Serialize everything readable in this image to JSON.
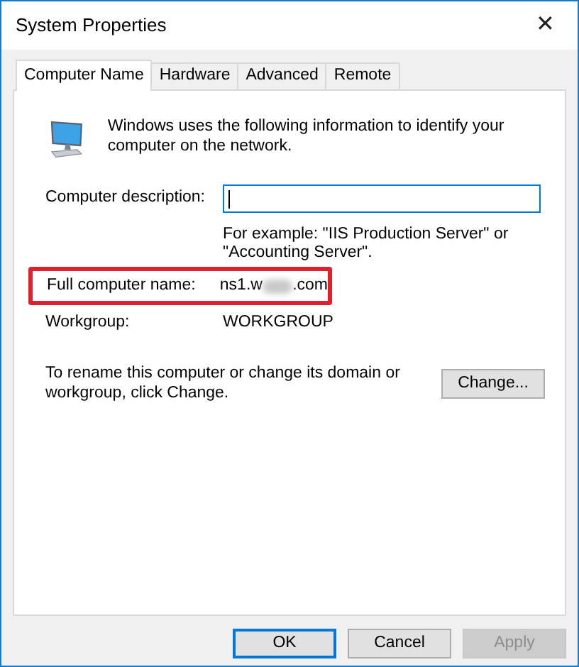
{
  "window": {
    "title": "System Properties",
    "close": "✕"
  },
  "tabs": [
    {
      "label": "Computer Name",
      "selected": true
    },
    {
      "label": "Hardware",
      "selected": false
    },
    {
      "label": "Advanced",
      "selected": false
    },
    {
      "label": "Remote",
      "selected": false
    }
  ],
  "intro": "Windows uses the following information to identify your computer on the network.",
  "description": {
    "label": "Computer description:",
    "focused": true,
    "hint": "For example: \"IIS Production Server\" or \"Accounting Server\"."
  },
  "full_name": {
    "label": "Full computer name:",
    "value_start": "ns1.w",
    "value_end": ".com",
    "highlighted": true
  },
  "workgroup": {
    "label": "Workgroup:",
    "value": "WORKGROUP"
  },
  "rename": {
    "text": "To rename this computer or change its domain or workgroup, click Change.",
    "button": "Change..."
  },
  "buttons": [
    {
      "label": "OK",
      "default": true,
      "disabled": false
    },
    {
      "label": "Cancel",
      "default": false,
      "disabled": false
    },
    {
      "label": "Apply",
      "default": false,
      "disabled": true
    }
  ]
}
